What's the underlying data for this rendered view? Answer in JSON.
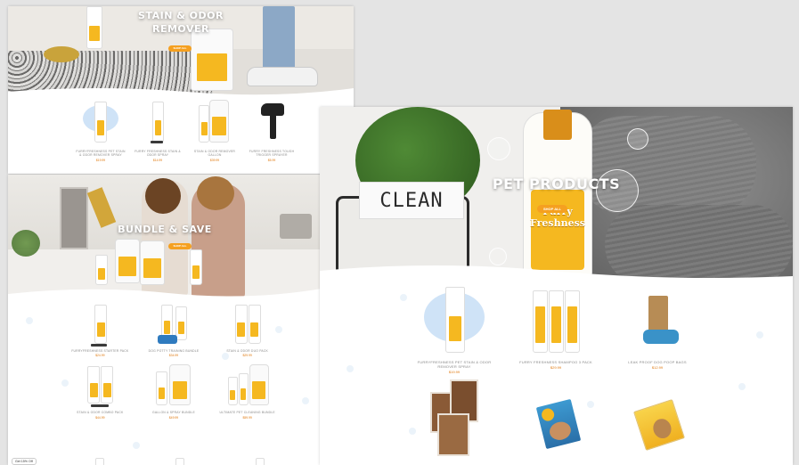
{
  "panel_left_top": {
    "hero_title_line1": "STAIN & ODOR",
    "hero_title_line2": "REMOVER",
    "shop_label": "SHOP ALL",
    "products": [
      {
        "caption": "FURRYFRESHNESS PET STAIN & ODOR REMOVER SPRAY",
        "price": "$19.99"
      },
      {
        "caption": "FURRY FRESHNESS STAIN & ODOR SPRAY",
        "price": "$14.99"
      },
      {
        "caption": "STAIN & ODOR REMOVER GALLON",
        "price": "$39.99"
      },
      {
        "caption": "FURRY FRESHNESS TOUGH TRIGGER SPRAYER",
        "price": "$5.99"
      }
    ]
  },
  "panel_left_bottom": {
    "hero_title": "BUNDLE & SAVE",
    "shop_label": "SHOP ALL",
    "products": [
      {
        "caption": "FURRYFRESHNESS STARTER PACK",
        "price": "$24.99"
      },
      {
        "caption": "DOG POTTY TRAINING BUNDLE",
        "price": "$34.99"
      },
      {
        "caption": "STAIN & ODOR DUO PACK",
        "price": "$29.99"
      },
      {
        "caption": "STAIN & ODOR COMBO PACK",
        "price": "$44.99"
      },
      {
        "caption": "GALLON & SPRAY BUNDLE",
        "price": "$49.99"
      },
      {
        "caption": "ULTIMATE PET CLEANING BUNDLE",
        "price": "$59.99"
      }
    ],
    "corner_badge": "Get 15% Off"
  },
  "panel_right": {
    "hero_title": "PET PRODUCTS",
    "sign_text": "CLEAN",
    "shop_label": "SHOP ALL",
    "bottle_brand_line1": "Furry",
    "bottle_brand_line2": "Freshness",
    "products": [
      {
        "caption": "FURRYFRESHNESS PET STAIN & ODOR REMOVER SPRAY",
        "price": "$19.99"
      },
      {
        "caption": "FURRY FRESHNESS SHAMPOO 3 PACK",
        "price": "$29.99"
      },
      {
        "caption": "LEAK PROOF DOG POOP BAGS",
        "price": "$12.99"
      },
      {
        "caption": "",
        "price": ""
      },
      {
        "caption": "",
        "price": ""
      },
      {
        "caption": "",
        "price": ""
      }
    ]
  },
  "colors": {
    "accent": "#f5a020",
    "label_yellow": "#f5b820",
    "paw_blue": "#dbe9f6"
  }
}
